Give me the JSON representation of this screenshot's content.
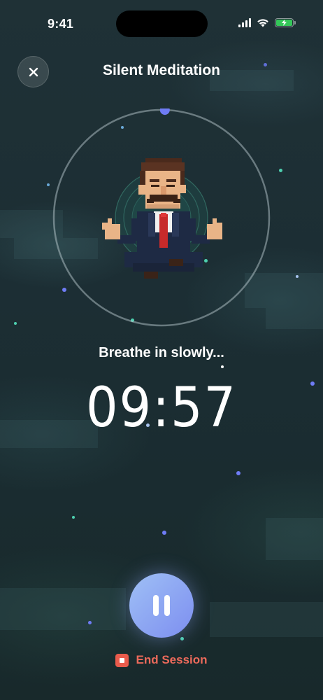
{
  "status_bar": {
    "time": "9:41",
    "icons": [
      "signal-icon",
      "wifi-icon",
      "battery-charging-icon"
    ]
  },
  "header": {
    "title": "Silent Meditation",
    "close_icon": "close-icon"
  },
  "session": {
    "breath_prompt": "Breathe in slowly...",
    "timer": "09:57",
    "progress_fraction": 0.005
  },
  "controls": {
    "pause_icon": "pause-icon",
    "end_label": "End Session",
    "end_icon": "stop-icon"
  },
  "colors": {
    "accent_blue": "#7d8ef0",
    "indicator_dot": "#6f7cf5",
    "end_red": "#ec6a5b",
    "battery_green": "#34c759"
  }
}
